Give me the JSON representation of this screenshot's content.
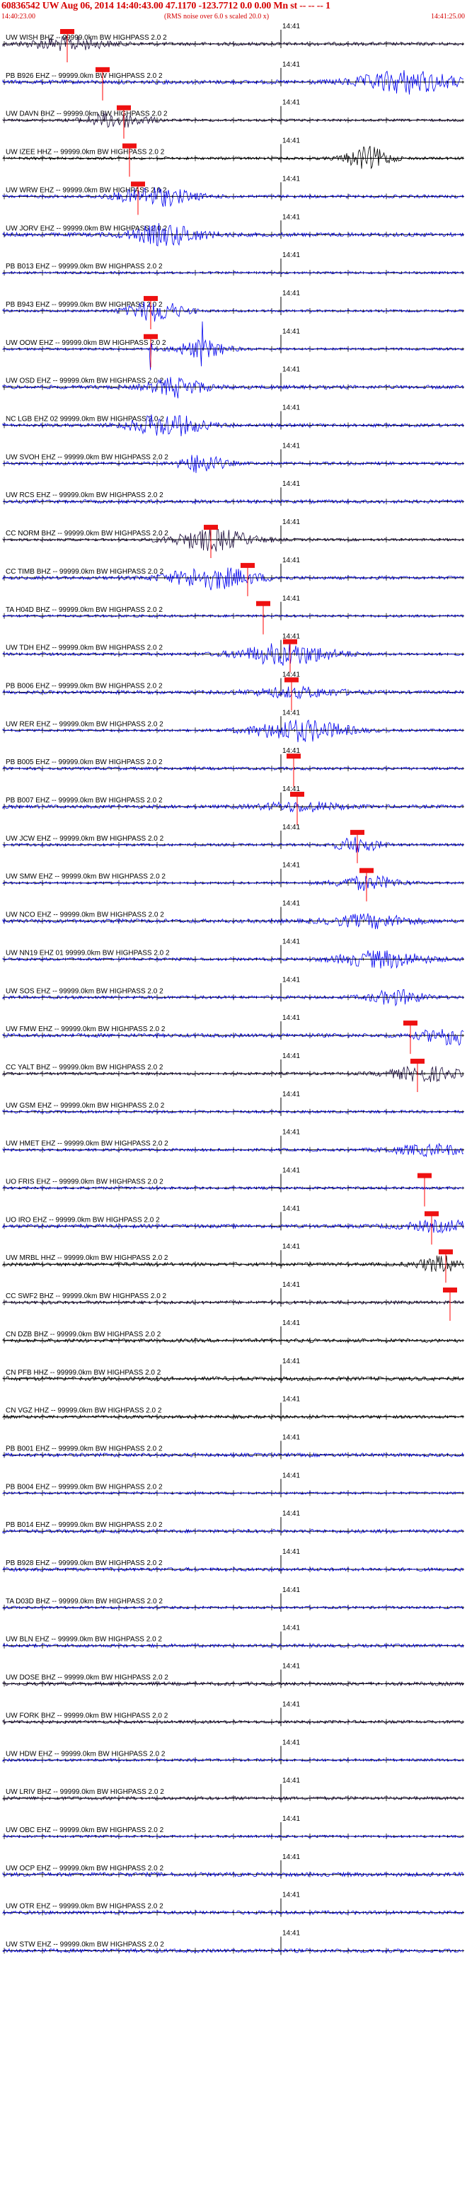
{
  "header": {
    "title": "60836542 UW Aug 06, 2014 14:40:43.00   47.1170 -123.7712  0.0 0.00 Mn st -- -- -- 1",
    "start_time": "14:40:23.00",
    "end_time": "14:41:25.00",
    "note": "(RMS noise over 6.0 s scaled 20.0 x)"
  },
  "colors": {
    "header_text": "#d40000",
    "pick_box": "#ee1111",
    "pick_line": "#ff0000",
    "trace_blue": "#0000ee",
    "trace_dark": "#1a0a3a",
    "trace_black": "#000000",
    "axis": "#000000"
  },
  "chart_data": {
    "type": "line",
    "x_unit": "time",
    "time_range": [
      "14:40:23.00",
      "14:41:25.00"
    ],
    "minute_tick_label": "14:41",
    "traces": [
      {
        "label": "UW WISH BHZ -- 99999.0km BW  HIGHPASS  2.0  2",
        "color": "dark",
        "pick": true
      },
      {
        "label": "PB B926 EHZ -- 99999.0km BW  HIGHPASS  2.0  2",
        "color": "blue",
        "pick": true
      },
      {
        "label": "UW DAVN BHZ -- 99999.0km BW  HIGHPASS  2.0  2",
        "color": "dark",
        "pick": true
      },
      {
        "label": "UW IZEE HHZ -- 99999.0km BW  HIGHPASS  2.0  2",
        "color": "black",
        "pick": true
      },
      {
        "label": "UW WRW EHZ -- 99999.0km BW  HIGHPASS  2.0  2",
        "color": "blue",
        "pick": true
      },
      {
        "label": "UW JORV EHZ -- 99999.0km BW  HIGHPASS  2.0  2",
        "color": "blue",
        "pick": false
      },
      {
        "label": "PB B013 EHZ -- 99999.0km BW  HIGHPASS  2.0  2",
        "color": "blue",
        "pick": false
      },
      {
        "label": "PB B943 EHZ -- 99999.0km BW  HIGHPASS  2.0  2",
        "color": "blue",
        "pick": true
      },
      {
        "label": "UW OOW EHZ -- 99999.0km BW  HIGHPASS  2.0  2",
        "color": "blue",
        "pick": true
      },
      {
        "label": "UW OSD EHZ -- 99999.0km BW  HIGHPASS  2.0  2",
        "color": "blue",
        "pick": false
      },
      {
        "label": "NC LGB EHZ 02 99999.0km BW  HIGHPASS  2.0  2",
        "color": "blue",
        "pick": false
      },
      {
        "label": "UW SVOH EHZ -- 99999.0km BW  HIGHPASS  2.0  2",
        "color": "blue",
        "pick": false
      },
      {
        "label": "UW RCS EHZ -- 99999.0km BW  HIGHPASS  2.0  2",
        "color": "blue",
        "pick": false
      },
      {
        "label": "CC NORM BHZ -- 99999.0km BW  HIGHPASS  2.0  2",
        "color": "dark",
        "pick": true
      },
      {
        "label": "CC TIMB BHZ -- 99999.0km BW  HIGHPASS  2.0  2",
        "color": "blue",
        "pick": true
      },
      {
        "label": "TA H04D BHZ -- 99999.0km BW  HIGHPASS  2.0  2",
        "color": "blue",
        "pick": true
      },
      {
        "label": "UW TDH EHZ -- 99999.0km BW  HIGHPASS  2.0  2",
        "color": "blue",
        "pick": true
      },
      {
        "label": "PB B006 EHZ -- 99999.0km BW  HIGHPASS  2.0  2",
        "color": "blue",
        "pick": true
      },
      {
        "label": "UW RER EHZ -- 99999.0km BW  HIGHPASS  2.0  2",
        "color": "blue",
        "pick": false
      },
      {
        "label": "PB B005 EHZ -- 99999.0km BW  HIGHPASS  2.0  2",
        "color": "blue",
        "pick": true
      },
      {
        "label": "PB B007 EHZ -- 99999.0km BW  HIGHPASS  2.0  2",
        "color": "blue",
        "pick": true
      },
      {
        "label": "UW JCW EHZ -- 99999.0km BW  HIGHPASS  2.0  2",
        "color": "blue",
        "pick": true
      },
      {
        "label": "UW SMW EHZ -- 99999.0km BW  HIGHPASS  2.0  2",
        "color": "blue",
        "pick": true
      },
      {
        "label": "UW NCO EHZ -- 99999.0km BW  HIGHPASS  2.0  2",
        "color": "blue",
        "pick": false
      },
      {
        "label": "UW NN19 EHZ 01 99999.0km BW  HIGHPASS  2.0  2",
        "color": "blue",
        "pick": false
      },
      {
        "label": "UW SOS EHZ -- 99999.0km BW  HIGHPASS  2.0  2",
        "color": "blue",
        "pick": false
      },
      {
        "label": "UW FMW EHZ -- 99999.0km BW  HIGHPASS  2.0  2",
        "color": "blue",
        "pick": true
      },
      {
        "label": "CC YALT BHZ -- 99999.0km BW  HIGHPASS  2.0  2",
        "color": "dark",
        "pick": true
      },
      {
        "label": "UW GSM EHZ -- 99999.0km BW  HIGHPASS  2.0  2",
        "color": "blue",
        "pick": false
      },
      {
        "label": "UW HMET EHZ -- 99999.0km BW  HIGHPASS  2.0  2",
        "color": "blue",
        "pick": false
      },
      {
        "label": "UO FRIS EHZ -- 99999.0km BW  HIGHPASS  2.0  2",
        "color": "blue",
        "pick": true
      },
      {
        "label": "UO IRO EHZ -- 99999.0km BW  HIGHPASS  2.0  2",
        "color": "blue",
        "pick": true
      },
      {
        "label": "UW MRBL HHZ -- 99999.0km BW  HIGHPASS  2.0  2",
        "color": "black",
        "pick": true
      },
      {
        "label": "CC SWF2 BHZ -- 99999.0km BW  HIGHPASS  2.0  2",
        "color": "dark",
        "pick": true
      },
      {
        "label": "CN DZB BHZ -- 99999.0km BW  HIGHPASS  2.0  2",
        "color": "black",
        "pick": false
      },
      {
        "label": "CN PFB HHZ -- 99999.0km BW  HIGHPASS  2.0  2",
        "color": "black",
        "pick": false
      },
      {
        "label": "CN VGZ HHZ -- 99999.0km BW  HIGHPASS  2.0  2",
        "color": "black",
        "pick": false
      },
      {
        "label": "PB B001 EHZ -- 99999.0km BW  HIGHPASS  2.0  2",
        "color": "blue",
        "pick": false
      },
      {
        "label": "PB B004 EHZ -- 99999.0km BW  HIGHPASS  2.0  2",
        "color": "blue",
        "pick": false
      },
      {
        "label": "PB B014 EHZ -- 99999.0km BW  HIGHPASS  2.0  2",
        "color": "blue",
        "pick": false
      },
      {
        "label": "PB B928 EHZ -- 99999.0km BW  HIGHPASS  2.0  2",
        "color": "blue",
        "pick": false
      },
      {
        "label": "TA D03D BHZ -- 99999.0km BW  HIGHPASS  2.0  2",
        "color": "blue",
        "pick": false
      },
      {
        "label": "UW BLN EHZ -- 99999.0km BW  HIGHPASS  2.0  2",
        "color": "blue",
        "pick": false
      },
      {
        "label": "UW DOSE BHZ -- 99999.0km BW  HIGHPASS  2.0  2",
        "color": "dark",
        "pick": false
      },
      {
        "label": "UW FORK BHZ -- 99999.0km BW  HIGHPASS  2.0  2",
        "color": "dark",
        "pick": false
      },
      {
        "label": "UW HDW EHZ -- 99999.0km BW  HIGHPASS  2.0  2",
        "color": "blue",
        "pick": false
      },
      {
        "label": "UW LRIV BHZ -- 99999.0km BW  HIGHPASS  2.0  2",
        "color": "dark",
        "pick": false
      },
      {
        "label": "UW OBC EHZ -- 99999.0km BW  HIGHPASS  2.0  2",
        "color": "blue",
        "pick": false
      },
      {
        "label": "UW OCP EHZ -- 99999.0km BW  HIGHPASS  2.0  2",
        "color": "blue",
        "pick": false
      },
      {
        "label": "UW OTR EHZ -- 99999.0km BW  HIGHPASS  2.0  2",
        "color": "blue",
        "pick": false
      },
      {
        "label": "UW STW EHZ -- 99999.0km BW  HIGHPASS  2.0  2",
        "color": "blue",
        "pick": false
      }
    ]
  }
}
